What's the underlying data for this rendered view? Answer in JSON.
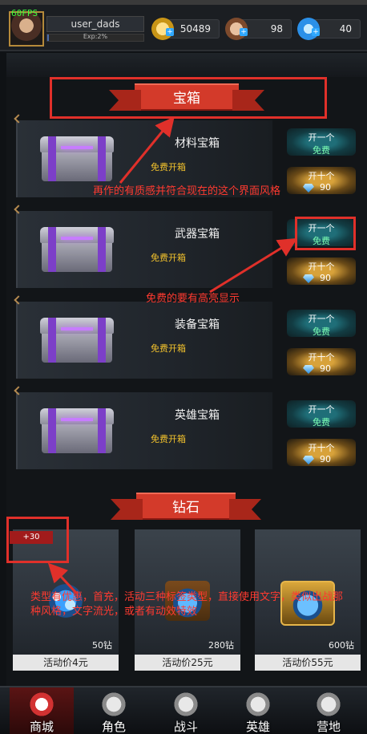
{
  "hud": {
    "fps": "60FPS",
    "username": "user_dads",
    "exp_text": "Exp:2%",
    "exp_fraction": 0.02,
    "gold": "50489",
    "stamina": "98",
    "gems": "40",
    "icons": [
      "gold-coin-icon",
      "cake-icon",
      "diamond-icon"
    ]
  },
  "sections": {
    "chest_title": "宝箱",
    "diamond_title": "钻石"
  },
  "chests": [
    {
      "name": "材料宝箱",
      "free_label": "免费开箱",
      "open_one": "开一个",
      "open_one_price": "免费",
      "open_ten": "开十个",
      "open_ten_price": "90"
    },
    {
      "name": "武器宝箱",
      "free_label": "免费开箱",
      "open_one": "开一个",
      "open_one_price": "免费",
      "open_ten": "开十个",
      "open_ten_price": "90"
    },
    {
      "name": "装备宝箱",
      "free_label": "免费开箱",
      "open_one": "开一个",
      "open_one_price": "免费",
      "open_ten": "开十个",
      "open_ten_price": "90"
    },
    {
      "name": "英雄宝箱",
      "free_label": "免费开箱",
      "open_one": "开一个",
      "open_one_price": "免费",
      "open_ten": "开十个",
      "open_ten_price": "90"
    }
  ],
  "diamond_packs": [
    {
      "badge": "+30",
      "amount": "50钻",
      "price": "活动价4元"
    },
    {
      "amount": "280钻",
      "price": "活动价25元"
    },
    {
      "amount": "600钻",
      "price": "活动价55元"
    }
  ],
  "annotations": {
    "texture_note": "再作的有质感并符合现在的这个界面风格",
    "free_note": "免费的要有高亮显示",
    "tag_note": "类型有优惠，首充，活动三种标签类型，直接使用文字，类似出战那种风格，文字流光，或者有动效特效"
  },
  "nav": {
    "items": [
      "商城",
      "角色",
      "战斗",
      "英雄",
      "营地"
    ],
    "active": "商城"
  },
  "colors": {
    "accent_red": "#d33a2a",
    "annotation_red": "#e0302a",
    "free_green": "#7dffb3",
    "free_label_yellow": "#f2c22c"
  }
}
